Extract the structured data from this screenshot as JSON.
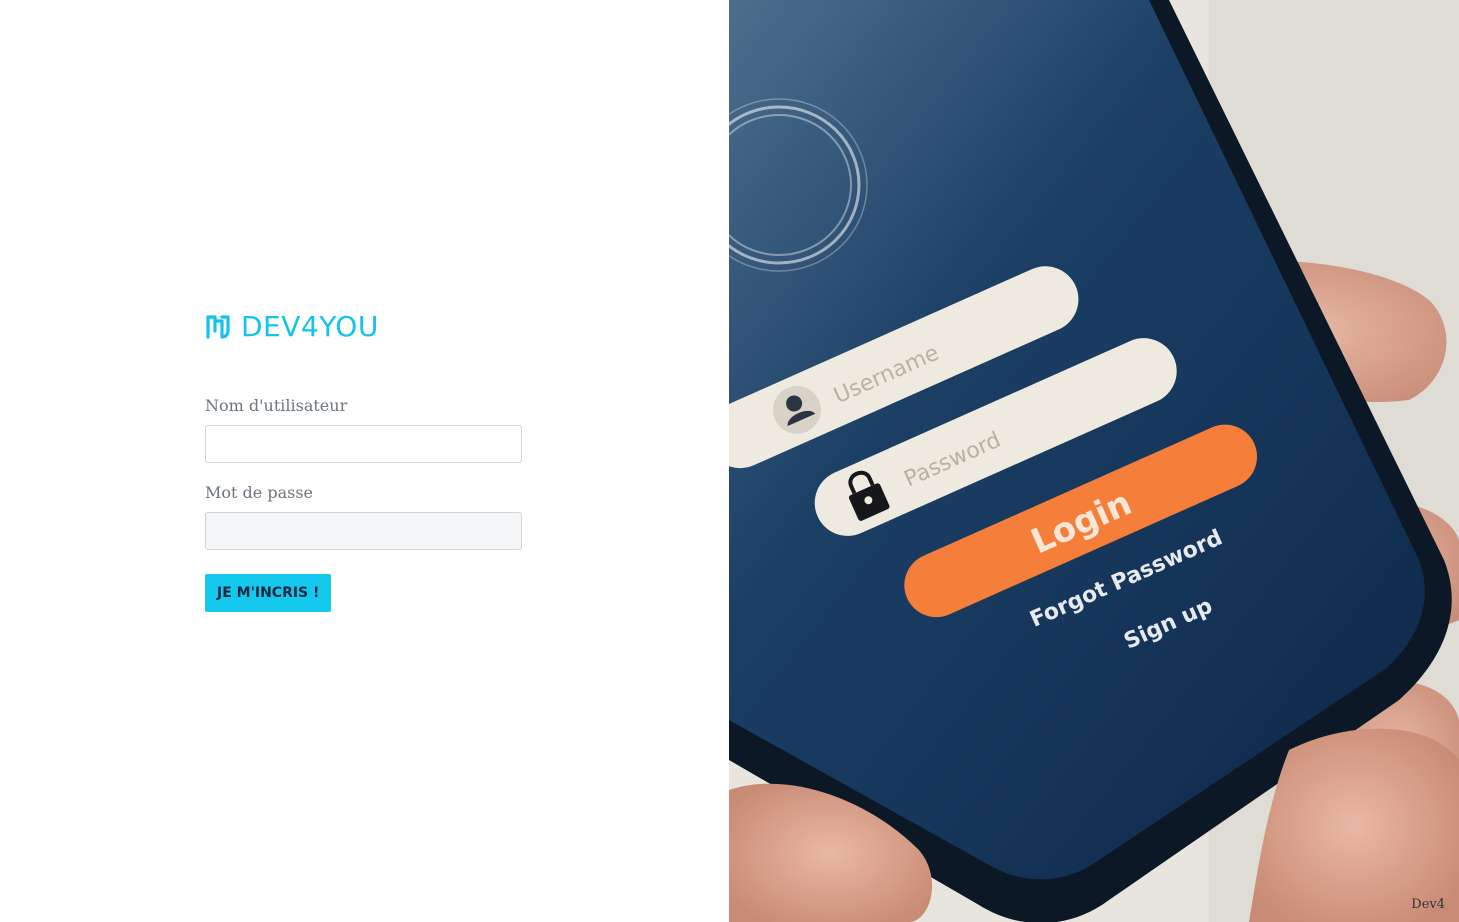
{
  "brand": {
    "name": "DEV4YOU",
    "icon": "dev4you-logo-icon",
    "color": "#14c2ee"
  },
  "form": {
    "username_label": "Nom d'utilisateur",
    "username_value": "",
    "password_label": "Mot de passe",
    "password_value": "",
    "submit_label": "JE M'INCRIS !"
  },
  "photo": {
    "username_placeholder": "Username",
    "password_placeholder": "Password",
    "login_label": "Login",
    "forgot_label": "Forgot Password",
    "signup_label": "Sign up",
    "user_icon": "user-icon",
    "lock_icon": "lock-icon"
  },
  "footer": {
    "credit": "Dev4"
  },
  "colors": {
    "accent": "#14c8ee",
    "login_button": "#f57f3a",
    "phone_screen": "#0f2d52"
  }
}
